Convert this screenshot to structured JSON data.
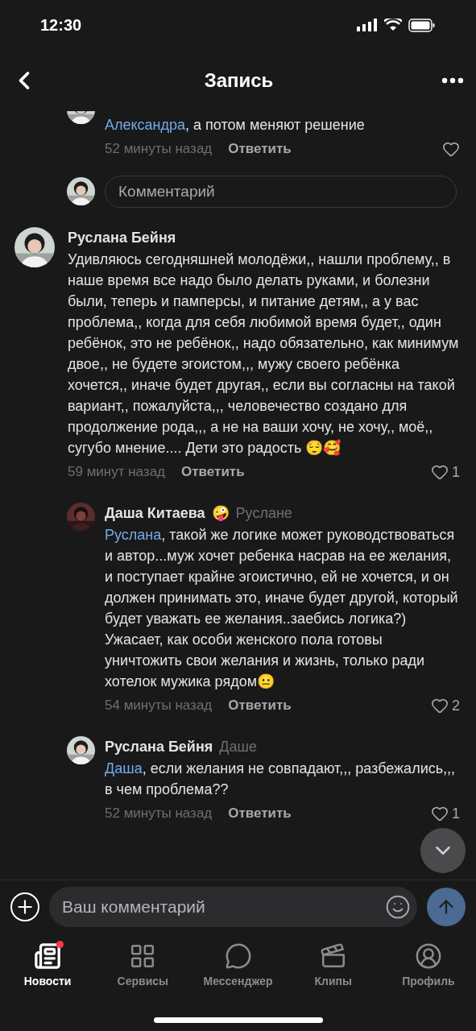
{
  "status_bar": {
    "time": "12:30"
  },
  "header": {
    "title": "Запись"
  },
  "partial_comment": {
    "mention": "Александра",
    "text": ", а потом меняют решение",
    "time": "52 минуты назад",
    "reply": "Ответить"
  },
  "comment_field": {
    "placeholder": "Комментарий"
  },
  "comments": [
    {
      "kind": "comment",
      "author": "Руслана Бейня",
      "text": "Удивляюсь сегодняшней молодёжи,, нашли проблему,, в наше время все надо было делать руками, и болезни были, теперь и памперсы, и питание детям,, а у вас проблема,, когда для себя любимой время будет,, один ребёнок, это не ребёнок,, надо обязательно, как минимум двое,, не будете эгоистом,,, мужу своего ребёнка хочется,, иначе будет другая,, если вы согласны на такой вариант,, пожалуйста,,, человечество создано для продолжение рода,,, а не на ваши хочу, не хочу,, моё,, сугубо мнение.... Дети это радость 😌🥰",
      "time": "59 минут назад",
      "reply": "Ответить",
      "likes": "1"
    },
    {
      "kind": "reply",
      "author": "Даша Китаева",
      "author_emoji": "🤪",
      "reply_to": "Руслане",
      "mention": "Руслана",
      "text": ", такой же логике может руководствоваться и автор...муж хочет ребенка насрав на ее желания, и поступает крайне эгоистично, ей не хочется, и он должен принимать это, иначе будет другой, который будет уважать ее желания..заебись логика?) Ужасает, как особи женского пола готовы уничтожить свои желания и жизнь, только ради хотелок  мужика рядом😐",
      "time": "54 минуты назад",
      "reply": "Ответить",
      "likes": "2"
    },
    {
      "kind": "reply",
      "author": "Руслана Бейня",
      "reply_to": "Даше",
      "mention": "Даша",
      "text": ", если желания не совпадают,,, разбежались,,, в чем проблема??",
      "time": "52 минуты назад",
      "reply": "Ответить",
      "likes": "1"
    }
  ],
  "composer": {
    "placeholder": "Ваш комментарий"
  },
  "tabs": [
    {
      "label": "Новости",
      "selected": true,
      "badge": true
    },
    {
      "label": "Сервисы",
      "selected": false,
      "badge": false
    },
    {
      "label": "Мессенджер",
      "selected": false,
      "badge": false
    },
    {
      "label": "Клипы",
      "selected": false,
      "badge": false
    },
    {
      "label": "Профиль",
      "selected": false,
      "badge": false
    }
  ]
}
